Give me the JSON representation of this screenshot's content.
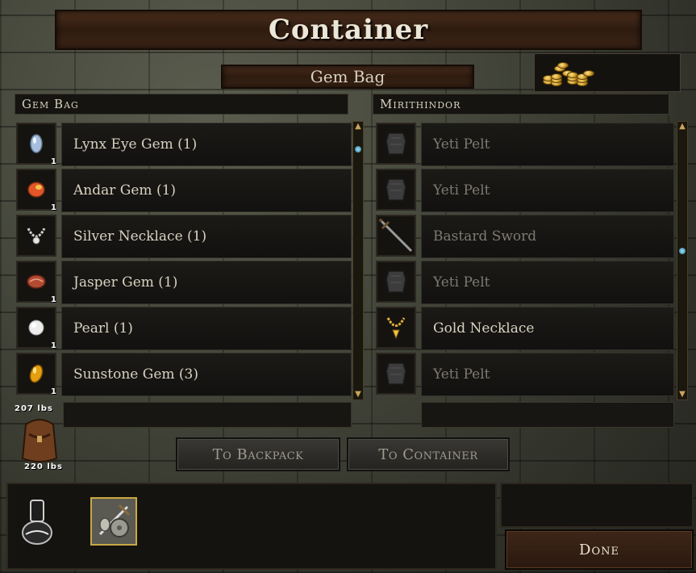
{
  "title": "Container",
  "container_name": "Gem Bag",
  "left_panel": {
    "header": "Gem Bag",
    "items": [
      {
        "name": "Lynx Eye Gem (1)",
        "qty": "1",
        "icon": "lynx-eye-gem-icon",
        "color": "#9fb6d8"
      },
      {
        "name": "Andar Gem (1)",
        "qty": "1",
        "icon": "andar-gem-icon",
        "color": "#e85a2a"
      },
      {
        "name": "Silver Necklace (1)",
        "qty": "",
        "icon": "silver-necklace-icon",
        "color": "#d8d8d8"
      },
      {
        "name": "Jasper Gem (1)",
        "qty": "1",
        "icon": "jasper-gem-icon",
        "color": "#c0553a"
      },
      {
        "name": "Pearl (1)",
        "qty": "1",
        "icon": "pearl-icon",
        "color": "#f2f2f2"
      },
      {
        "name": "Sunstone Gem (3)",
        "qty": "1",
        "icon": "sunstone-gem-icon",
        "color": "#e8a212"
      }
    ]
  },
  "right_panel": {
    "header": "Mirithindor",
    "items": [
      {
        "name": "Yeti Pelt",
        "icon": "yeti-pelt-icon",
        "active": false
      },
      {
        "name": "Yeti Pelt",
        "icon": "yeti-pelt-icon",
        "active": false
      },
      {
        "name": "Bastard Sword",
        "icon": "bastard-sword-icon",
        "active": false
      },
      {
        "name": "Yeti Pelt",
        "icon": "yeti-pelt-icon",
        "active": false
      },
      {
        "name": "Gold Necklace",
        "icon": "gold-necklace-icon",
        "active": true
      },
      {
        "name": "Yeti Pelt",
        "icon": "yeti-pelt-icon",
        "active": false
      }
    ]
  },
  "weight": {
    "current": "207 lbs",
    "max": "220 lbs"
  },
  "buttons": {
    "to_backpack": "To Backpack",
    "to_container": "To Container",
    "done": "Done"
  },
  "colors": {
    "active_text": "#d8d2c0",
    "dim_text": "#7e7a72",
    "gold": "#e0b23a"
  }
}
